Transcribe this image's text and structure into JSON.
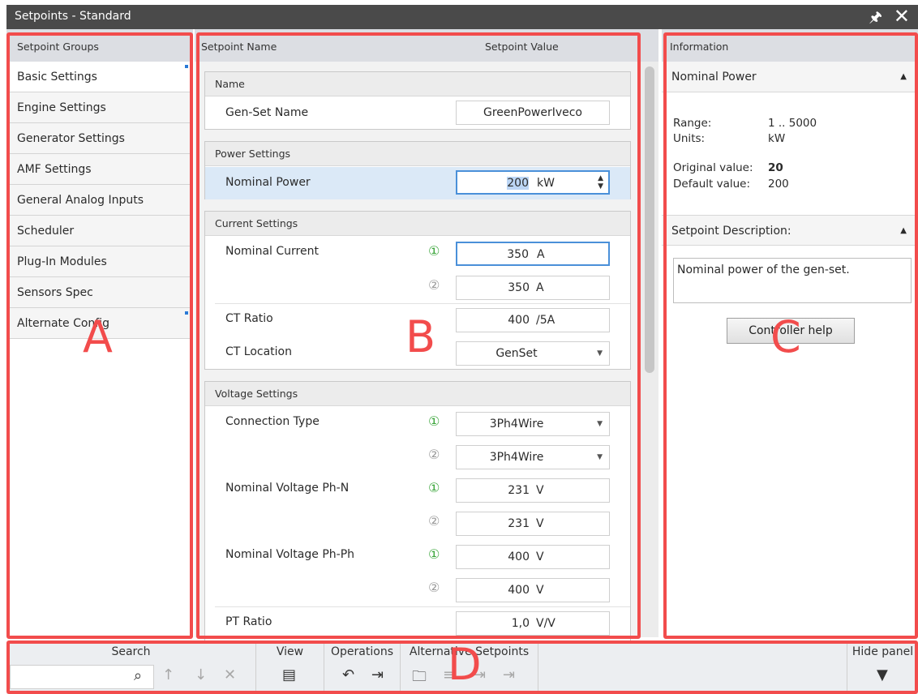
{
  "window": {
    "title": "Setpoints - Standard",
    "pin_icon": "pin-icon",
    "close_icon": "close-icon"
  },
  "groups": {
    "header": "Setpoint Groups",
    "items": [
      {
        "label": "Basic Settings",
        "marked": true
      },
      {
        "label": "Engine Settings"
      },
      {
        "label": "Generator Settings"
      },
      {
        "label": "AMF Settings"
      },
      {
        "label": "General Analog Inputs"
      },
      {
        "label": "Scheduler"
      },
      {
        "label": "Plug-In Modules"
      },
      {
        "label": "Sensors Spec"
      },
      {
        "label": "Alternate Config",
        "marked": true
      }
    ]
  },
  "setpoints": {
    "col_name": "Setpoint Name",
    "col_value": "Setpoint Value",
    "sections": {
      "name": "Name",
      "power": "Power Settings",
      "current": "Current Settings",
      "voltage": "Voltage Settings"
    },
    "rows": {
      "genset_name": {
        "label": "Gen-Set Name",
        "value": "GreenPowerIveco"
      },
      "nominal_power": {
        "label": "Nominal Power",
        "value": "200",
        "unit": "kW"
      },
      "nominal_current": {
        "label": "Nominal Current",
        "v1": "350",
        "v2": "350",
        "unit": "A"
      },
      "ct_ratio": {
        "label": "CT Ratio",
        "value": "400",
        "unit": "/5A"
      },
      "ct_location": {
        "label": "CT Location",
        "value": "GenSet"
      },
      "connection_type": {
        "label": "Connection Type",
        "v1": "3Ph4Wire",
        "v2": "3Ph4Wire"
      },
      "nom_v_phn": {
        "label": "Nominal Voltage Ph-N",
        "v1": "231",
        "v2": "231",
        "unit": "V"
      },
      "nom_v_phph": {
        "label": "Nominal Voltage Ph-Ph",
        "v1": "400",
        "v2": "400",
        "unit": "V"
      },
      "pt_ratio": {
        "label": "PT Ratio",
        "value": "1,0",
        "unit": "V/V"
      }
    },
    "sub1": "①",
    "sub2": "②"
  },
  "info": {
    "header": "Information",
    "title": "Nominal Power",
    "range_label": "Range:",
    "range_value": "1 .. 5000",
    "units_label": "Units:",
    "units_value": "kW",
    "orig_label": "Original value:",
    "orig_value": "20",
    "default_label": "Default value:",
    "default_value": "200",
    "desc_header": "Setpoint Description:",
    "desc_text": "Nominal power of the gen-set.",
    "help_button": "Controller help"
  },
  "toolbar": {
    "search": "Search",
    "view": "View",
    "operations": "Operations",
    "alternative": "Alternative Setpoints",
    "hide": "Hide panel"
  },
  "annotations": {
    "a": "A",
    "b": "B",
    "c": "C",
    "d": "D",
    "color": "#f24c4c"
  }
}
